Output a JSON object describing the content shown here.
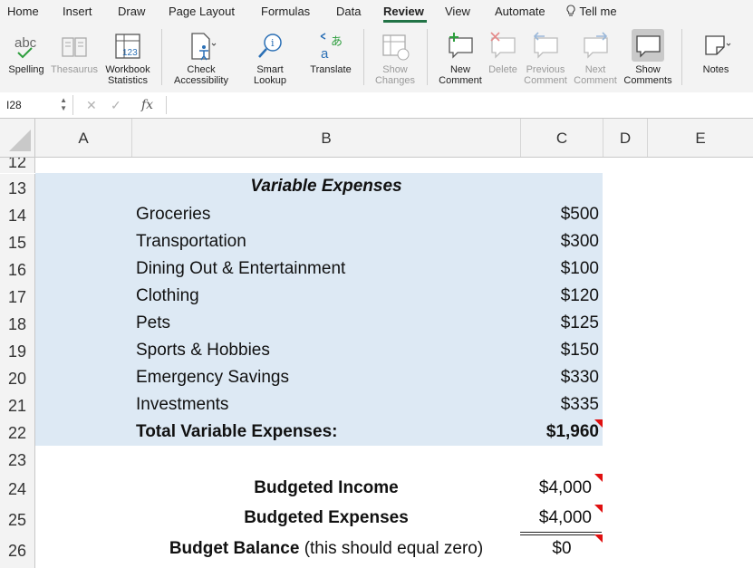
{
  "menu": {
    "tabs": [
      "Home",
      "Insert",
      "Draw",
      "Page Layout",
      "Formulas",
      "Data",
      "Review",
      "View",
      "Automate"
    ],
    "active": "Review",
    "tell_me": "Tell me"
  },
  "ribbon": {
    "spelling": "Spelling",
    "spelling_icon_text": "abc",
    "thesaurus": "Thesaurus",
    "workbook_statistics": "Workbook\nStatistics",
    "workbook_icon_text": "123",
    "check_accessibility": "Check\nAccessibility",
    "smart_lookup": "Smart\nLookup",
    "translate": "Translate",
    "translate_icon_a": "a",
    "translate_icon_b": "あ",
    "show_changes": "Show\nChanges",
    "new_comment": "New\nComment",
    "delete": "Delete",
    "previous_comment": "Previous\nComment",
    "next_comment": "Next\nComment",
    "show_comments": "Show\nComments",
    "notes": "Notes"
  },
  "formula_bar": {
    "name_box": "I28",
    "fx": "fx",
    "cancel_glyph": "✕",
    "confirm_glyph": "✓"
  },
  "columns": [
    "A",
    "B",
    "C",
    "D",
    "E"
  ],
  "rows": [
    "12",
    "13",
    "14",
    "15",
    "16",
    "17",
    "18",
    "19",
    "20",
    "21",
    "22",
    "23",
    "24",
    "25",
    "26"
  ],
  "sheet": {
    "header": "Variable Expenses",
    "items": [
      {
        "label": "Groceries",
        "value": "$500"
      },
      {
        "label": "Transportation",
        "value": "$300"
      },
      {
        "label": "Dining Out & Entertainment",
        "value": "$100"
      },
      {
        "label": "Clothing",
        "value": "$120"
      },
      {
        "label": "Pets",
        "value": "$125"
      },
      {
        "label": "Sports & Hobbies",
        "value": "$150"
      },
      {
        "label": "Emergency Savings",
        "value": "$330"
      },
      {
        "label": "Investments",
        "value": "$335"
      }
    ],
    "total_label": "Total Variable Expenses:",
    "total_value": "$1,960",
    "income_label": "Budgeted Income",
    "income_value": "$4,000",
    "expenses_label": "Budgeted Expenses",
    "expenses_value": "$4,000",
    "balance_label": "Budget Balance",
    "balance_note": "(this should equal zero)",
    "balance_value": "$0"
  },
  "colors": {
    "accent": "#217346",
    "selection_fill": "#dde9f4",
    "comment_marker": "#e01010"
  }
}
